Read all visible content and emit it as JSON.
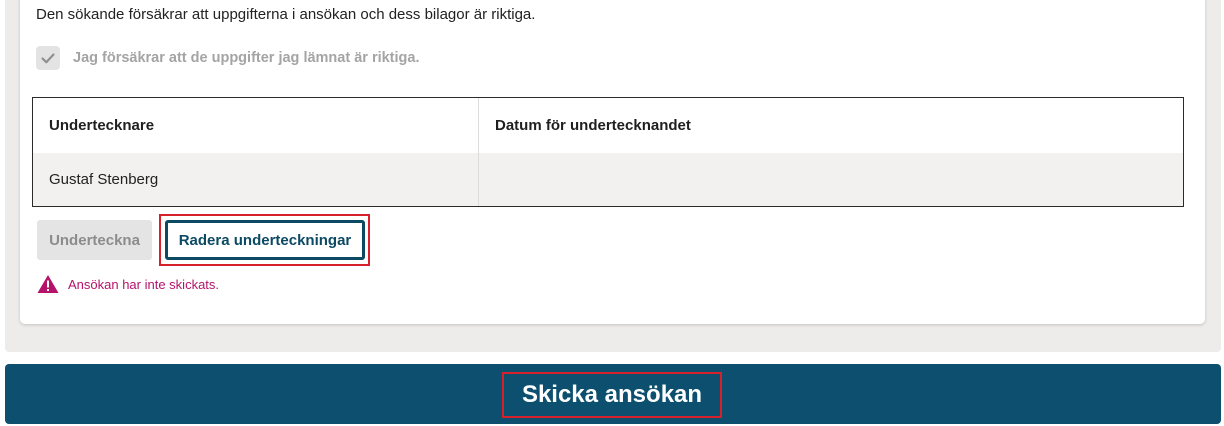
{
  "declaration": {
    "intro_text": "Den sökande försäkrar att uppgifterna i ansökan och dess bilagor är riktiga.",
    "checkbox_label": "Jag försäkrar att de uppgifter jag lämnat är riktiga.",
    "checkbox_checked": true
  },
  "signatures": {
    "columns": [
      "Undertecknare",
      "Datum för undertecknandet"
    ],
    "rows": [
      {
        "signer": "Gustaf Stenberg",
        "date": ""
      }
    ]
  },
  "actions": {
    "sign_label": "Underteckna",
    "delete_label": "Radera underteckningar"
  },
  "status": {
    "message": "Ansökan har inte skickats.",
    "icon": "warning-triangle-icon"
  },
  "submit": {
    "label": "Skicka ansökan"
  },
  "colors": {
    "primary": "#0c4f6e",
    "error": "#b5136b",
    "highlight": "#d8202c"
  }
}
